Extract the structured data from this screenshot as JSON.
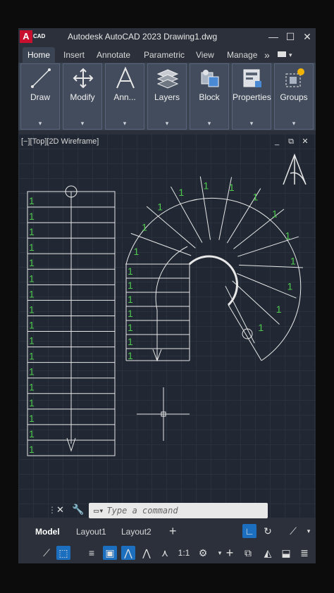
{
  "app": {
    "logo_letter": "A",
    "logo_text": "CAD",
    "title": "Autodesk AutoCAD 2023    Drawing1.dwg",
    "window_controls": [
      "minimize-icon",
      "maximize-icon",
      "close-icon"
    ]
  },
  "ribbon_tabs": [
    "Home",
    "Insert",
    "Annotate",
    "Parametric",
    "View",
    "Manage"
  ],
  "ribbon_tabs_more": "»",
  "ribbon_panels": [
    {
      "label": "Draw",
      "icon": "line-icon"
    },
    {
      "label": "Modify",
      "icon": "move-icon"
    },
    {
      "label": "Ann...",
      "icon": "text-icon"
    },
    {
      "label": "Layers",
      "icon": "layers-icon"
    },
    {
      "label": "Block",
      "icon": "block-icon"
    },
    {
      "label": "Properties",
      "icon": "properties-icon"
    },
    {
      "label": "Groups",
      "icon": "groups-icon"
    }
  ],
  "panel_expand_glyph": "▾",
  "viewport": {
    "label": "[−][Top][2D Wireframe]",
    "controls": [
      "minimize-icon",
      "restore-icon",
      "close-icon"
    ],
    "stair_number": "1"
  },
  "command_line": {
    "placeholder": "Type a command",
    "icons": [
      "close-icon",
      "wrench-icon",
      "command-prompt-icon"
    ]
  },
  "layout_tabs": [
    "Model",
    "Layout1",
    "Layout2"
  ],
  "add_layout": "+",
  "status_bar": {
    "scale": "1:1",
    "icons": [
      "snap-icon",
      "grid-icon",
      "ortho-icon",
      "polar-icon",
      "osnap-icon",
      "lineweight-icon",
      "select-icon",
      "annotation-icon",
      "scale-icon",
      "gear-icon",
      "plus-icon",
      "isolate-icon",
      "hardware-icon",
      "fullscreen-icon",
      "menu-icon"
    ]
  },
  "colors": {
    "accent": "#1c6fbf",
    "stair_number": "#4ec94e",
    "logo": "#c8102e"
  }
}
